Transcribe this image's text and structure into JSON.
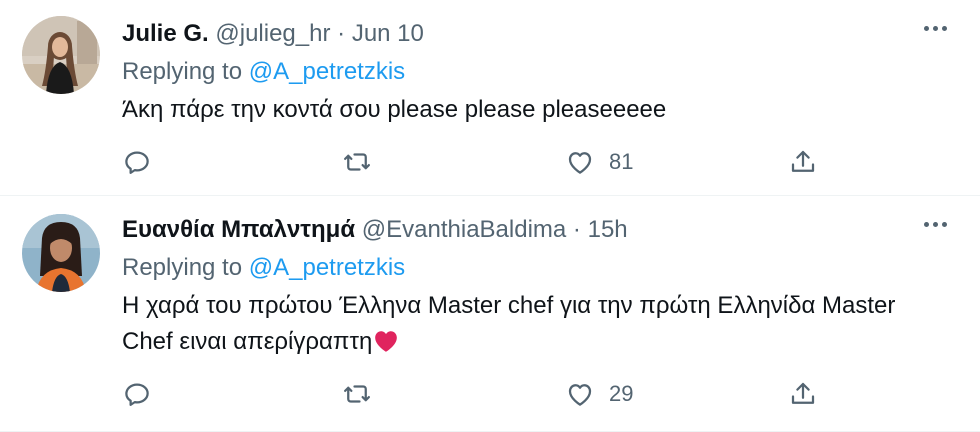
{
  "tweets": [
    {
      "name": "Julie G.",
      "handle": "@julieg_hr",
      "separator": "·",
      "time": "Jun 10",
      "replying_prefix": "Replying to",
      "replying_to": "@A_petretzkis",
      "text": "Άκη πάρε την κοντά σου please please pleaseeeee",
      "likes": "81",
      "icons": [
        "reply-icon",
        "retweet-icon",
        "like-icon",
        "share-icon",
        "more-icon"
      ]
    },
    {
      "name": "Ευανθία Μπαλντημά",
      "handle": "@EvanthiaBaldima",
      "separator": "·",
      "time": "15h",
      "replying_prefix": "Replying to",
      "replying_to": "@A_petretzkis",
      "text_line1": "Η χαρά του πρώτου Έλληνα Master chef για την πρώτη Ελληνίδα Master",
      "text_line2": "Chef ειναι απερίγραπτη",
      "likes": "29",
      "icons": [
        "reply-icon",
        "retweet-icon",
        "like-icon",
        "share-icon",
        "more-icon",
        "heart-emoji-icon"
      ]
    }
  ],
  "colors": {
    "text": "#0f1419",
    "muted": "#536471",
    "link": "#1d9bf0",
    "heart": "#e0245e"
  }
}
